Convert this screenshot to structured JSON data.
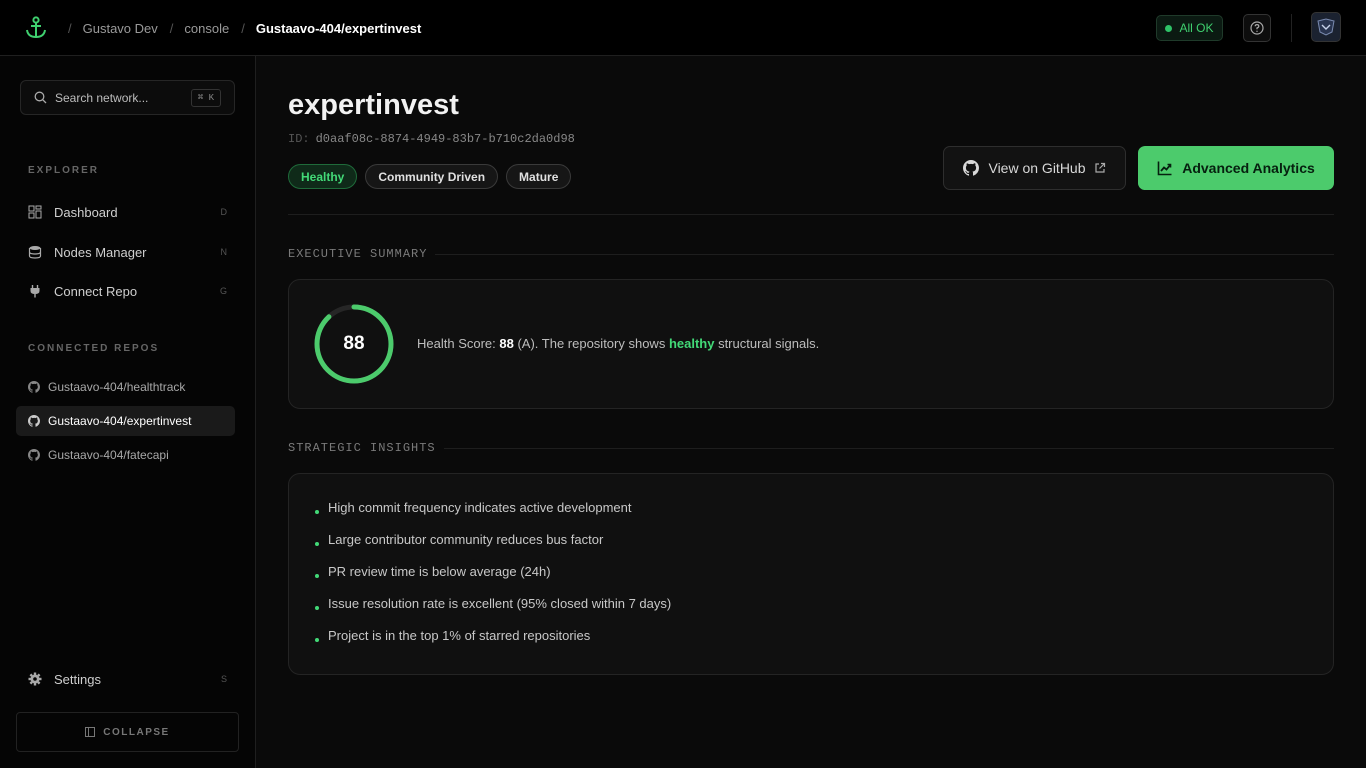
{
  "topbar": {
    "breadcrumb": [
      "Gustavo Dev",
      "console",
      "Gustaavo-404/expertinvest"
    ],
    "status": "All OK"
  },
  "sidebar": {
    "search_placeholder": "Search network...",
    "search_shortcut": "⌘ K",
    "explorer_label": "EXPLORER",
    "nav": [
      {
        "label": "Dashboard",
        "hotkey": "D",
        "icon": "dashboard-icon"
      },
      {
        "label": "Nodes Manager",
        "hotkey": "N",
        "icon": "database-icon"
      },
      {
        "label": "Connect Repo",
        "hotkey": "G",
        "icon": "plug-icon"
      }
    ],
    "repos_label": "CONNECTED REPOS",
    "repos": [
      "Gustaavo-404/healthtrack",
      "Gustaavo-404/expertinvest",
      "Gustaavo-404/fatecapi"
    ],
    "settings": {
      "label": "Settings",
      "hotkey": "S"
    },
    "collapse_label": "COLLAPSE"
  },
  "main": {
    "title": "expertinvest",
    "id_label": "ID:",
    "id_value": "d0aaf08c-8874-4949-83b7-b710c2da0d98",
    "tags": [
      "Healthy",
      "Community Driven",
      "Mature"
    ],
    "github_button": "View on GitHub",
    "analytics_button": "Advanced Analytics",
    "summary_heading": "EXECUTIVE SUMMARY",
    "health_score": 88,
    "health_fraction": 0.88,
    "summary_prefix": "Health Score: ",
    "summary_score": "88",
    "summary_mid": " (A). The repository shows ",
    "summary_highlight": "healthy",
    "summary_suffix": " structural signals.",
    "insights_heading": "STRATEGIC INSIGHTS",
    "insights": [
      "High commit frequency indicates active development",
      "Large contributor community reduces bus factor",
      "PR review time is below average (24h)",
      "Issue resolution rate is excellent (95% closed within 7 days)",
      "Project is in the top 1% of starred repositories"
    ]
  },
  "colors": {
    "accent": "#4ccb6c",
    "accent_text": "#42d977",
    "background": "#0a0a0a"
  }
}
